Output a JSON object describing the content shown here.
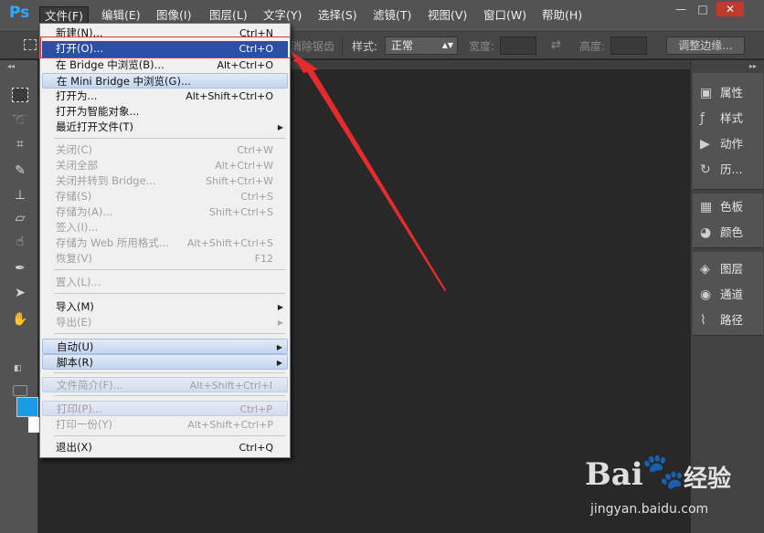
{
  "app": {
    "logo": "Ps"
  },
  "menubar": {
    "items": [
      "文件(F)",
      "编辑(E)",
      "图像(I)",
      "图层(L)",
      "文字(Y)",
      "选择(S)",
      "滤镜(T)",
      "视图(V)",
      "窗口(W)",
      "帮助(H)"
    ],
    "active_index": 0,
    "window_controls": {
      "minimize": "—",
      "restore": "□",
      "close": "✕"
    }
  },
  "options_bar": {
    "antialias_label": "消除锯齿",
    "style_label": "样式:",
    "style_value": "正常",
    "width_label": "宽度:",
    "height_label": "高度:",
    "refine_button": "调整边缘..."
  },
  "toolbar": {
    "tools": [
      "rectangular-marquee-icon",
      "lasso-icon",
      "crop-icon",
      "healing-brush-icon",
      "clone-stamp-icon",
      "eraser-icon",
      "smudge-icon",
      "pen-icon",
      "path-selection-icon",
      "hand-icon"
    ],
    "foreground_color": "#1a9be6",
    "background_color": "#ffffff"
  },
  "right_panel": {
    "group1": [
      {
        "label": "属性",
        "icon": "properties-icon"
      },
      {
        "label": "样式",
        "icon": "styles-icon"
      },
      {
        "label": "动作",
        "icon": "actions-icon"
      },
      {
        "label": "历...",
        "icon": "history-icon"
      }
    ],
    "group2": [
      {
        "label": "色板",
        "icon": "swatches-icon"
      },
      {
        "label": "颜色",
        "icon": "color-icon"
      }
    ],
    "group3": [
      {
        "label": "图层",
        "icon": "layers-icon"
      },
      {
        "label": "通道",
        "icon": "channels-icon"
      },
      {
        "label": "路径",
        "icon": "paths-icon"
      }
    ]
  },
  "file_menu": {
    "items": [
      {
        "label": "新建(N)...",
        "shortcut": "Ctrl+N",
        "state": "normal"
      },
      {
        "label": "打开(O)...",
        "shortcut": "Ctrl+O",
        "state": "selected"
      },
      {
        "label": "在 Bridge 中浏览(B)...",
        "shortcut": "Alt+Ctrl+O",
        "state": "normal"
      },
      {
        "label": "在 Mini Bridge 中浏览(G)...",
        "shortcut": "",
        "state": "hover"
      },
      {
        "label": "打开为...",
        "shortcut": "Alt+Shift+Ctrl+O",
        "state": "normal"
      },
      {
        "label": "打开为智能对象...",
        "shortcut": "",
        "state": "normal"
      },
      {
        "label": "最近打开文件(T)",
        "shortcut": "",
        "state": "normal",
        "submenu": true
      },
      {
        "label": "关闭(C)",
        "shortcut": "Ctrl+W",
        "state": "disabled"
      },
      {
        "label": "关闭全部",
        "shortcut": "Alt+Ctrl+W",
        "state": "disabled"
      },
      {
        "label": "关闭并转到 Bridge...",
        "shortcut": "Shift+Ctrl+W",
        "state": "disabled"
      },
      {
        "label": "存储(S)",
        "shortcut": "Ctrl+S",
        "state": "disabled"
      },
      {
        "label": "存储为(A)...",
        "shortcut": "Shift+Ctrl+S",
        "state": "disabled"
      },
      {
        "label": "签入(I)...",
        "shortcut": "",
        "state": "disabled"
      },
      {
        "label": "存储为 Web 所用格式...",
        "shortcut": "Alt+Shift+Ctrl+S",
        "state": "disabled"
      },
      {
        "label": "恢复(V)",
        "shortcut": "F12",
        "state": "disabled"
      },
      {
        "label": "置入(L)...",
        "shortcut": "",
        "state": "disabled"
      },
      {
        "label": "导入(M)",
        "shortcut": "",
        "state": "normal",
        "submenu": true
      },
      {
        "label": "导出(E)",
        "shortcut": "",
        "state": "disabled",
        "submenu": true
      },
      {
        "label": "自动(U)",
        "shortcut": "",
        "state": "hover",
        "submenu": true
      },
      {
        "label": "脚本(R)",
        "shortcut": "",
        "state": "hover",
        "submenu": true
      },
      {
        "label": "文件简介(F)...",
        "shortcut": "Alt+Shift+Ctrl+I",
        "state": "hover-disabled"
      },
      {
        "label": "打印(P)...",
        "shortcut": "Ctrl+P",
        "state": "hover-disabled"
      },
      {
        "label": "打印一份(Y)",
        "shortcut": "Alt+Shift+Ctrl+P",
        "state": "disabled"
      },
      {
        "label": "退出(X)",
        "shortcut": "Ctrl+Q",
        "state": "normal"
      }
    ]
  },
  "annotation": {
    "color": "#e52b2b"
  },
  "watermark": {
    "brand": "Bai",
    "brand2": "经验",
    "url": "jingyan.baidu.com"
  }
}
